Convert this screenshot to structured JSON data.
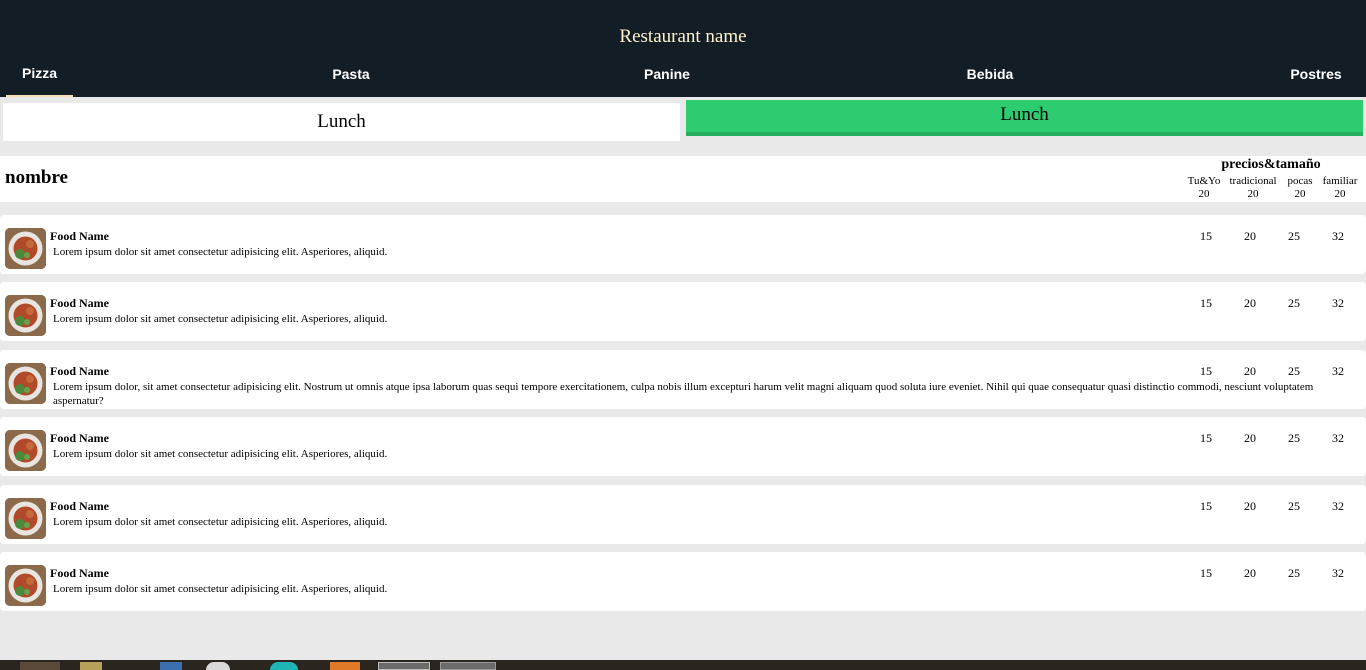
{
  "header": {
    "restaurant_name": "Restaurant name",
    "tabs": [
      {
        "label": "Pizza",
        "active": true
      },
      {
        "label": "Pasta",
        "active": false
      },
      {
        "label": "Panine",
        "active": false
      },
      {
        "label": "Bebida",
        "active": false
      },
      {
        "label": "Postres",
        "active": false
      }
    ]
  },
  "lunch_buttons": {
    "left": "Lunch",
    "right": "Lunch"
  },
  "table": {
    "name_header": "nombre",
    "prices_header": "precios&tamaño",
    "sizes": [
      {
        "label": "Tu&Yo",
        "price": "20"
      },
      {
        "label": "tradicional",
        "price": "20"
      },
      {
        "label": "pocas",
        "price": "20"
      },
      {
        "label": "familiar",
        "price": "20"
      }
    ]
  },
  "items": [
    {
      "name": "Food Name",
      "description": "Lorem ipsum dolor sit amet consectetur adipisicing elit. Asperiores, aliquid.",
      "prices": [
        "15",
        "20",
        "25",
        "32"
      ]
    },
    {
      "name": "Food Name",
      "description": "Lorem ipsum dolor sit amet consectetur adipisicing elit. Asperiores, aliquid.",
      "prices": [
        "15",
        "20",
        "25",
        "32"
      ]
    },
    {
      "name": "Food Name",
      "description": "Lorem ipsum dolor, sit amet consectetur adipisicing elit. Nostrum ut omnis atque ipsa laborum quas sequi tempore exercitationem, culpa nobis illum excepturi harum velit magni aliquam quod soluta iure eveniet. Nihil qui quae consequatur quasi distinctio commodi, nesciunt voluptatem aspernatur?",
      "prices": [
        "15",
        "20",
        "25",
        "32"
      ]
    },
    {
      "name": "Food Name",
      "description": "Lorem ipsum dolor sit amet consectetur adipisicing elit. Asperiores, aliquid.",
      "prices": [
        "15",
        "20",
        "25",
        "32"
      ]
    },
    {
      "name": "Food Name",
      "description": "Lorem ipsum dolor sit amet consectetur adipisicing elit. Asperiores, aliquid.",
      "prices": [
        "15",
        "20",
        "25",
        "32"
      ]
    },
    {
      "name": "Food Name",
      "description": "Lorem ipsum dolor sit amet consectetur adipisicing elit. Asperiores, aliquid.",
      "prices": [
        "15",
        "20",
        "25",
        "32"
      ]
    }
  ],
  "colors": {
    "header_bg": "#131d26",
    "title_color": "#fff3cc",
    "lunch_accent": "#2ecc71",
    "band_bg": "#e9e9e9"
  }
}
